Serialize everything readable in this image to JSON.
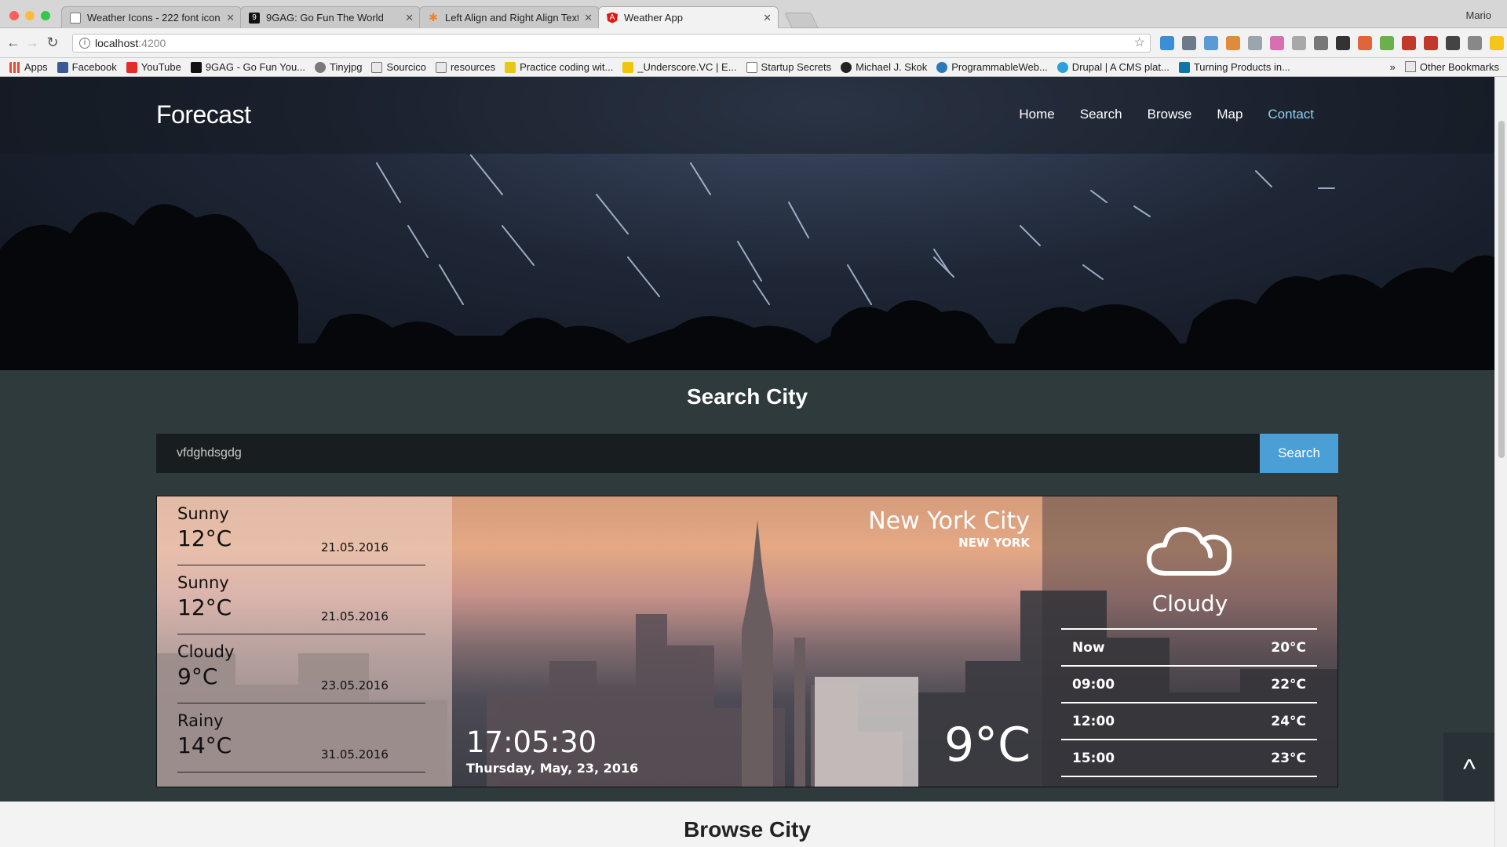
{
  "browser": {
    "user": "Mario",
    "tabs": [
      {
        "title": "Weather Icons - 222 font icons",
        "icon": "page-icon"
      },
      {
        "title": "9GAG: Go Fun The World",
        "icon": "9gag-icon"
      },
      {
        "title": "Left Align and Right Align Text",
        "icon": "stackoverflow-icon"
      },
      {
        "title": "Weather App",
        "icon": "angular-icon",
        "active": true
      }
    ],
    "url_host": "localhost",
    "url_port": ":4200",
    "bookmarks": [
      {
        "label": "Apps",
        "icon": "apps-icon",
        "color": "#e04b3a"
      },
      {
        "label": "Facebook",
        "icon": "facebook-icon",
        "color": "#3b5998"
      },
      {
        "label": "YouTube",
        "icon": "youtube-icon",
        "color": "#e52d27"
      },
      {
        "label": "9GAG - Go Fun You...",
        "icon": "9gag-icon",
        "color": "#111111"
      },
      {
        "label": "Tinyjpg",
        "icon": "panda-icon",
        "color": "#7a7a7a"
      },
      {
        "label": "Sourcico",
        "icon": "folder-icon",
        "color": "#b8b8b8"
      },
      {
        "label": "resources",
        "icon": "folder-icon",
        "color": "#b8b8b8"
      },
      {
        "label": "Practice coding wit...",
        "icon": "codewars-icon",
        "color": "#e8c61a"
      },
      {
        "label": "_Underscore.VC | E...",
        "icon": "underscore-icon",
        "color": "#f1c40f"
      },
      {
        "label": "Startup Secrets",
        "icon": "page-icon",
        "color": "#ffffff"
      },
      {
        "label": "Michael J. Skok",
        "icon": "circle-icon",
        "color": "#222222"
      },
      {
        "label": "ProgrammableWeb...",
        "icon": "gear-icon",
        "color": "#2b7ab8"
      },
      {
        "label": "Drupal | A CMS plat...",
        "icon": "drupal-icon",
        "color": "#2aa0dc"
      },
      {
        "label": "Turning Products in...",
        "icon": "linkedin-icon",
        "color": "#0e76a8"
      }
    ],
    "bookmarks_overflow": "»",
    "other_bookmarks": "Other Bookmarks"
  },
  "site": {
    "brand": "Forecast",
    "nav": [
      {
        "label": "Home"
      },
      {
        "label": "Search"
      },
      {
        "label": "Browse"
      },
      {
        "label": "Map"
      },
      {
        "label": "Contact",
        "active": true
      }
    ]
  },
  "search": {
    "title": "Search City",
    "value": "vfdghdsgdg",
    "button": "Search"
  },
  "weather": {
    "city": "New York City",
    "state": "NEW YORK",
    "time": "17:05:30",
    "date": "Thursday, May, 23, 2016",
    "temperature": "9°C",
    "current_condition": "Cloudy",
    "forecast": [
      {
        "condition": "Sunny",
        "temp": "12°C",
        "date": "21.05.2016"
      },
      {
        "condition": "Sunny",
        "temp": "12°C",
        "date": "21.05.2016"
      },
      {
        "condition": "Cloudy",
        "temp": "9°C",
        "date": "23.05.2016"
      },
      {
        "condition": "Rainy",
        "temp": "14°C",
        "date": "31.05.2016"
      }
    ],
    "hourly": [
      {
        "time": "Now",
        "temp": "20°C"
      },
      {
        "time": "09:00",
        "temp": "22°C"
      },
      {
        "time": "12:00",
        "temp": "24°C"
      },
      {
        "time": "15:00",
        "temp": "23°C"
      }
    ]
  },
  "back_to_top": "^",
  "browse": {
    "title": "Browse City"
  },
  "colors": {
    "accent": "#4a9fd6",
    "nav_active": "#8fd0f0",
    "page_bg": "#2f3a3d"
  }
}
